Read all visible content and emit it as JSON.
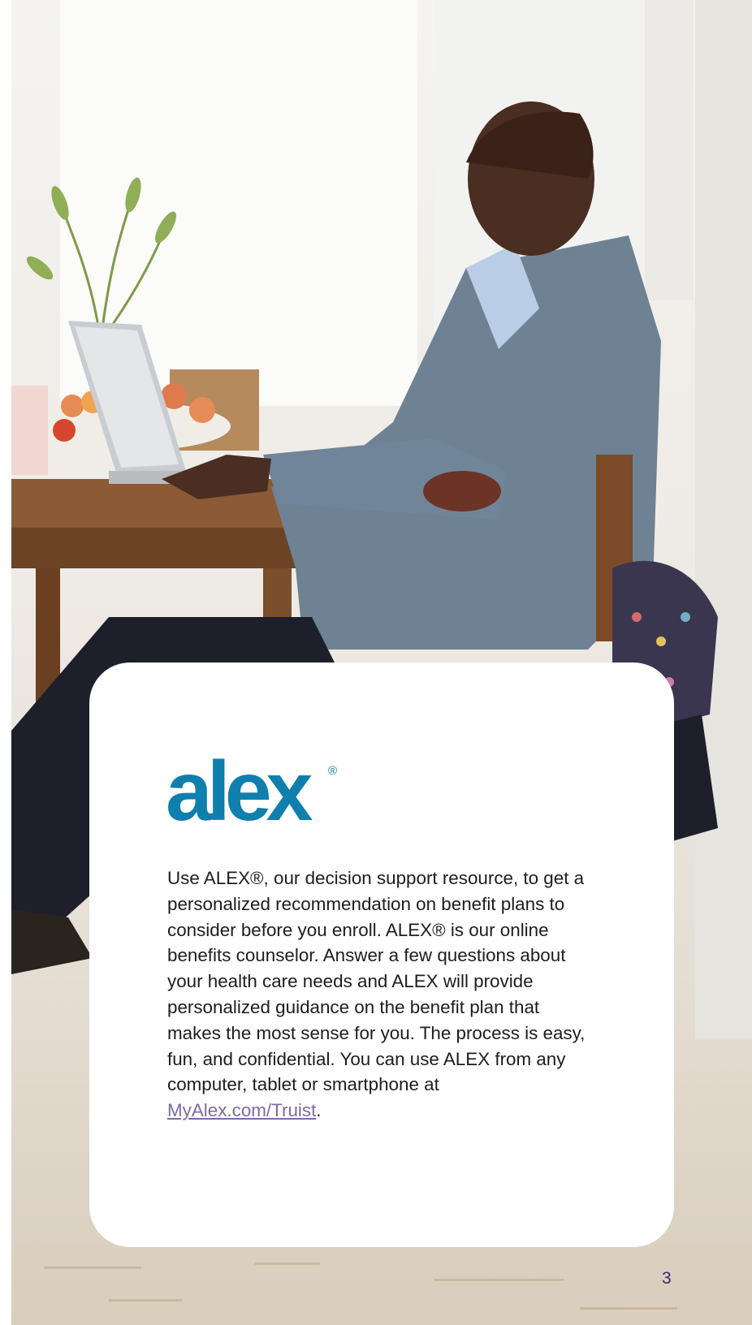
{
  "logo": {
    "text": "alex",
    "registered_mark": "®"
  },
  "body": {
    "text_before_link": "Use ALEX®, our decision support resource, to get a personalized recommendation on benefit plans to consider before you enroll. ALEX® is our online benefits counselor. Answer a few questions about your health care needs and ALEX will provide personalized guidance on the benefit plan that makes the most sense for you. The process is easy, fun, and confidential. You can use ALEX from any computer, tablet or smartphone at ",
    "link_text": "MyAlex.com/Truist",
    "text_after_link": "."
  },
  "page_number": "3",
  "colors": {
    "brand": "#0f7fae",
    "link": "#7b6aa6",
    "page_number": "#3a2a6a"
  }
}
